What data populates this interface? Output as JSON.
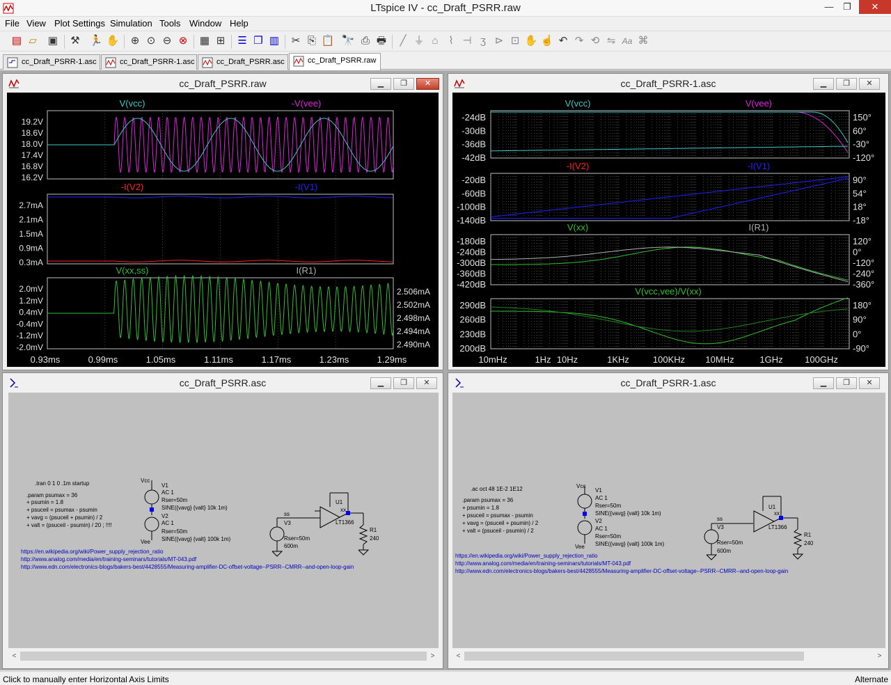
{
  "app": {
    "title": "LTspice IV - cc_Draft_PSRR.raw"
  },
  "window_controls": {
    "minimize": "—",
    "restore": "❐",
    "close": "✕"
  },
  "menu": [
    "File",
    "View",
    "Plot Settings",
    "Simulation",
    "Tools",
    "Window",
    "Help"
  ],
  "toolbar": {
    "icons": [
      "new-schematic-icon",
      "open-icon",
      "save-icon",
      "control-panel-icon",
      "run-icon",
      "halt-icon",
      "zoom-in-icon",
      "zoom-area-icon",
      "zoom-out-icon",
      "zoom-cancel-icon",
      "autorange-icon",
      "fit-icon",
      "tile-horizontal-icon",
      "cascade-icon",
      "tile-vertical-icon",
      "cut-icon",
      "copy-icon",
      "paste-icon",
      "find-icon",
      "print-preview-icon",
      "print-icon",
      "wire-icon",
      "ground-icon",
      "label-icon",
      "resistor-icon",
      "capacitor-icon",
      "inductor-icon",
      "diode-icon",
      "component-icon",
      "move-icon",
      "drag-icon",
      "undo-icon",
      "redo-icon",
      "rotate-icon",
      "mirror-icon",
      "text-icon",
      "spice-directive-icon"
    ]
  },
  "tabs": [
    {
      "label": "cc_Draft_PSRR-1.asc",
      "kind": "schematic"
    },
    {
      "label": "cc_Draft_PSRR-1.asc",
      "kind": "waveform"
    },
    {
      "label": "cc_Draft_PSRR.asc",
      "kind": "waveform"
    },
    {
      "label": "cc_Draft_PSRR.raw",
      "kind": "waveform",
      "active": true
    }
  ],
  "windows": {
    "tran_plot": {
      "title": "cc_Draft_PSRR.raw"
    },
    "ac_plot": {
      "title": "cc_Draft_PSRR-1.asc"
    },
    "tran_schematic": {
      "title": "cc_Draft_PSRR.asc"
    },
    "ac_schematic": {
      "title": "cc_Draft_PSRR-1.asc"
    }
  },
  "colors": {
    "cyan": "#3cc8c8",
    "magenta": "#e020e0",
    "red": "#ff2020",
    "blue": "#2020ff",
    "green": "#30c030",
    "gray": "#b0b0b0",
    "schematic_bg": "#c0c0c0",
    "schematic_text": "#000000",
    "link_text": "#0000c0"
  },
  "chart_data": [
    {
      "type": "line",
      "title": "cc_Draft_PSRR.raw",
      "x_ticks": [
        "0.93ms",
        "0.99ms",
        "1.05ms",
        "1.11ms",
        "1.17ms",
        "1.23ms",
        "1.29ms"
      ],
      "xlim": [
        0.93,
        1.29
      ],
      "panes": [
        {
          "series": [
            {
              "name": "V(vcc)",
              "color": "#3cc8c8"
            },
            {
              "name": "-V(vee)",
              "color": "#e020e0"
            }
          ],
          "y_ticks": [
            "19.2V",
            "18.6V",
            "18.0V",
            "17.4V",
            "16.8V",
            "16.2V"
          ],
          "ylim": [
            16.2,
            19.5
          ]
        },
        {
          "series": [
            {
              "name": "-I(V2)",
              "color": "#ff2020"
            },
            {
              "name": "-I(V1)",
              "color": "#2020ff"
            }
          ],
          "y_ticks": [
            "2.7mA",
            "2.1mA",
            "1.5mA",
            "0.9mA",
            "0.3mA"
          ],
          "ylim": [
            0.3,
            2.7
          ]
        },
        {
          "series": [
            {
              "name": "V(xx,ss)",
              "color": "#30c030"
            },
            {
              "name": "I(R1)",
              "color": "#b0b0b0"
            }
          ],
          "y_ticks": [
            "2.0mV",
            "1.2mV",
            "0.4mV",
            "-0.4mV",
            "-1.2mV",
            "-2.0mV"
          ],
          "ylim": [
            -2.0,
            2.0
          ],
          "y2_ticks": [
            "2.506mA",
            "2.502mA",
            "2.498mA",
            "2.494mA",
            "2.490mA"
          ]
        }
      ]
    },
    {
      "type": "line",
      "title": "cc_Draft_PSRR-1.asc",
      "x_ticks": [
        "10mHz",
        "1Hz",
        "10Hz",
        "1KHz",
        "100KHz",
        "10MHz",
        "1GHz",
        "100GHz"
      ],
      "log_x": true,
      "panes": [
        {
          "series": [
            {
              "name": "V(vcc)",
              "color": "#3cc8c8"
            },
            {
              "name": "V(vee)",
              "color": "#e020e0"
            }
          ],
          "y_ticks": [
            "-24dB",
            "-30dB",
            "-36dB",
            "-42dB"
          ],
          "y2_ticks": [
            "150°",
            "60°",
            "-30°",
            "-120°"
          ]
        },
        {
          "series": [
            {
              "name": "-I(V2)",
              "color": "#ff2020"
            },
            {
              "name": "-I(V1)",
              "color": "#2020ff"
            }
          ],
          "y_ticks": [
            "-20dB",
            "-60dB",
            "-100dB",
            "-140dB"
          ],
          "y2_ticks": [
            "90°",
            "54°",
            "18°",
            "-18°"
          ]
        },
        {
          "series": [
            {
              "name": "V(xx)",
              "color": "#30c030"
            },
            {
              "name": "I(R1)",
              "color": "#b0b0b0"
            }
          ],
          "y_ticks": [
            "-180dB",
            "-240dB",
            "-300dB",
            "-360dB",
            "-420dB"
          ],
          "y2_ticks": [
            "120°",
            "0°",
            "-120°",
            "-240°",
            "-360°"
          ]
        },
        {
          "series": [
            {
              "name": "V(vcc,vee)/V(xx)",
              "color": "#30c030"
            }
          ],
          "y_ticks": [
            "290dB",
            "260dB",
            "230dB",
            "200dB"
          ],
          "y2_ticks": [
            "180°",
            "90°",
            "0°",
            "-90°"
          ]
        }
      ]
    }
  ],
  "schematic_tran": {
    "directive": ".tran 0 1 0 .1m startup",
    "params": [
      ".param psumax = 36",
      "+ psumin = 1.8",
      "+ psuceil = psumax - psumin",
      "+ vavg = (psuceil + psumin) / 2",
      "+ valt = (psuceil - psumin) / 20 ; !!!!"
    ],
    "v1": {
      "name": "V1",
      "ac": "AC 1",
      "rser": "Rser=50m",
      "value": "SINE({vavg} {valt} 10k 1m)"
    },
    "v2": {
      "name": "V2",
      "ac": "AC 1",
      "rser": "Rser=50m",
      "value": "SINE({vavg} {valt} 100k 1m)"
    },
    "v3": {
      "name": "V3",
      "rser": "Rser=50m",
      "value": "600m"
    },
    "nets": {
      "vcc": "Vcc",
      "vee": "Vee",
      "ss": "ss",
      "xx": "xx"
    },
    "u1": {
      "name": "U1",
      "part": "LT1366"
    },
    "r1": {
      "name": "R1",
      "value": "240"
    },
    "links": [
      "https://en.wikipedia.org/wiki/Power_supply_rejection_ratio",
      "http://www.analog.com/media/en/training-seminars/tutorials/MT-043.pdf",
      "http://www.edn.com/electronics-blogs/bakers-best/4428555/Measuring-amplifier-DC-offset-voltage--PSRR--CMRR--and-open-loop-gain"
    ]
  },
  "schematic_ac": {
    "directive": ".ac oct 48 1E-2 1E12",
    "params": [
      ".param psumax = 36",
      "+ psumin = 1.8",
      "+ psuceil = psumax - psumin",
      "+ vavg = (psuceil + psumin) / 2",
      "+ valt = (psuceil - psumin) / 2"
    ],
    "v1": {
      "name": "V1",
      "ac": "AC 1",
      "rser": "Rser=50m",
      "value": "SINE({vavg} {valt} 10k 1m)"
    },
    "v2": {
      "name": "V2",
      "ac": "AC 1",
      "rser": "Rser=50m",
      "value": "SINE({vavg} {valt} 100k 1m)"
    },
    "v3": {
      "name": "V3",
      "rser": "Rser=50m",
      "value": "600m"
    },
    "nets": {
      "vcc": "Vcc",
      "vee": "Vee",
      "ss": "ss",
      "xx": "xx"
    },
    "u1": {
      "name": "U1",
      "part": "LT1366"
    },
    "r1": {
      "name": "R1",
      "value": "240"
    },
    "links": [
      "https://en.wikipedia.org/wiki/Power_supply_rejection_ratio",
      "http://www.analog.com/media/en/training-seminars/tutorials/MT-043.pdf",
      "http://www.edn.com/electronics-blogs/bakers-best/4428555/Measuring-amplifier-DC-offset-voltage--PSRR--CMRR--and-open-loop-gain"
    ]
  },
  "status": {
    "left": "Click to manually enter Horizontal Axis Limits",
    "right": "Alternate"
  }
}
